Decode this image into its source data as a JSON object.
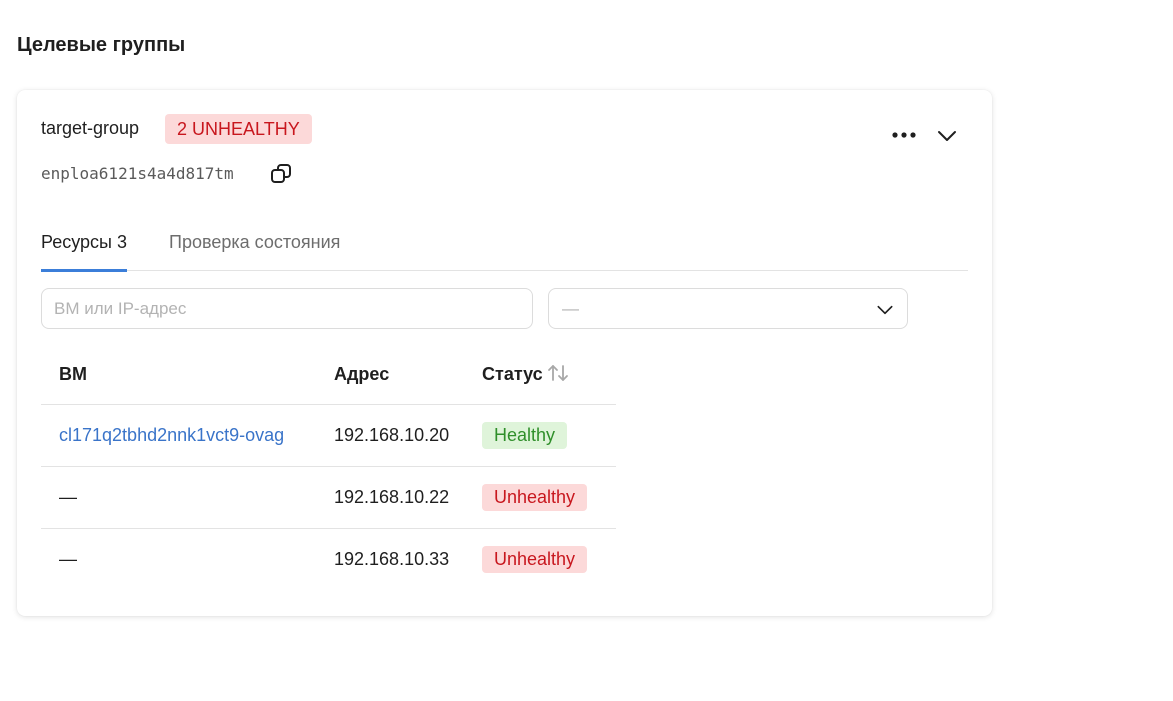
{
  "page": {
    "title": "Целевые группы"
  },
  "group": {
    "name": "target-group",
    "badge": "2 UNHEALTHY",
    "id": "enploa6121s4a4d817tm"
  },
  "tabs": [
    {
      "label": "Ресурсы 3",
      "active": true
    },
    {
      "label": "Проверка состояния",
      "active": false
    }
  ],
  "filters": {
    "search_placeholder": "ВМ или IP-адрес",
    "select_value": "—"
  },
  "table": {
    "columns": {
      "vm": "ВМ",
      "address": "Адрес",
      "status": "Статус"
    },
    "rows": [
      {
        "vm": "cl171q2tbhd2nnk1vct9-ovag",
        "vm_is_link": true,
        "address": "192.168.10.20",
        "status": "Healthy"
      },
      {
        "vm": "—",
        "vm_is_link": false,
        "address": "192.168.10.22",
        "status": "Unhealthy"
      },
      {
        "vm": "—",
        "vm_is_link": false,
        "address": "192.168.10.33",
        "status": "Unhealthy"
      }
    ]
  },
  "colors": {
    "accent": "#3b7ed9",
    "link": "#3a74c9",
    "healthy_bg": "#dff4da",
    "healthy_text": "#2f8f2a",
    "unhealthy_bg": "#fcd9d9",
    "unhealthy_text": "#c8171e"
  },
  "icons": {
    "copy": "copy-icon",
    "more": "more-horizontal-icon",
    "collapse": "chevron-down-icon",
    "select": "chevron-down-icon",
    "sort": "sort-arrows-icon"
  }
}
